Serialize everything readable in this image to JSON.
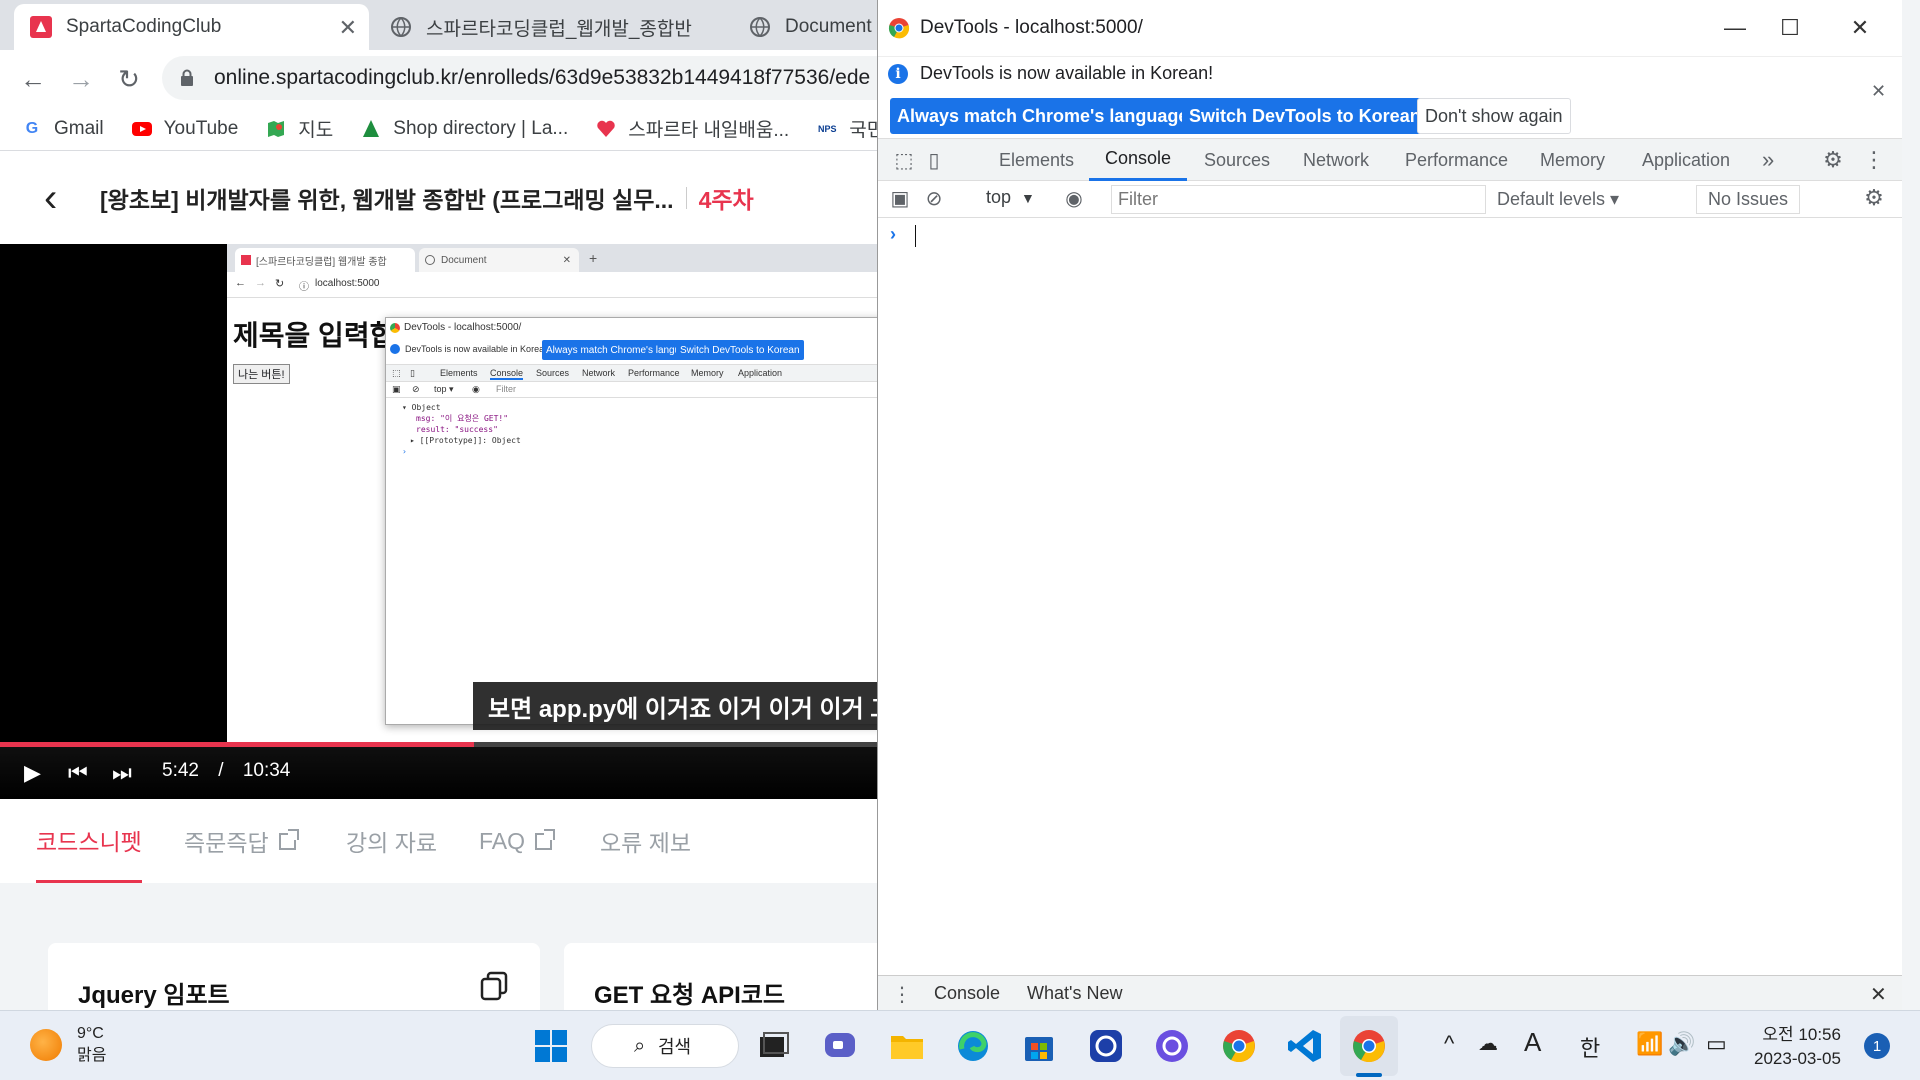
{
  "browser": {
    "tabs": [
      {
        "title": "SpartaCodingClub"
      },
      {
        "title": "스파르타코딩클럽_웹개발_종합반"
      },
      {
        "title": "Document"
      }
    ],
    "url": "online.spartacodingclub.kr/enrolleds/63d9e53832b1449418f77536/ede",
    "bookmarks": [
      {
        "label": "Gmail",
        "icon": "gmail-icon"
      },
      {
        "label": "YouTube",
        "icon": "youtube-icon"
      },
      {
        "label": "지도",
        "icon": "maps-icon"
      },
      {
        "label": "Shop directory | La...",
        "icon": "shop-icon"
      },
      {
        "label": "스파르타 내일배움...",
        "icon": "heart-icon"
      },
      {
        "label": "국민",
        "icon": "nps-icon"
      }
    ]
  },
  "course": {
    "title": "[왕초보] 비개발자를 위한, 웹개발 종합반 (프로그래밍 실무...",
    "week": "4주차"
  },
  "video": {
    "inner_tabs": [
      "[스파르타코딩클럽] 웹개발 종합",
      "Document"
    ],
    "inner_url": "localhost:5000",
    "inner_heading": "제목을 입력합",
    "inner_button": "나는 버튼!",
    "inner_devtools": {
      "title": "DevTools - localhost:5000/",
      "info": "DevTools is now available in Korean!",
      "btn1": "Always match Chrome's language",
      "btn2": "Switch DevTools to Korean",
      "tabs": [
        "Elements",
        "Console",
        "Sources",
        "Network",
        "Performance",
        "Memory",
        "Application"
      ],
      "context": "top ▾",
      "filter": "Filter",
      "object_label": "Object",
      "msg_line": "msg: \"이 요청은 GET!\"",
      "result_line": "result: \"success\"",
      "proto_line": "[[Prototype]]: Object"
    },
    "subtitle": "보면 app.py에 이거죠 이거 이거 이거 그",
    "current_time": "5:42",
    "separator": "/",
    "duration": "10:34",
    "progress_fraction": 0.54
  },
  "page_tabs": [
    {
      "label": "코드스니펫",
      "active": true,
      "external": false
    },
    {
      "label": "즉문즉답",
      "active": false,
      "external": true
    },
    {
      "label": "강의 자료",
      "active": false,
      "external": false
    },
    {
      "label": "FAQ",
      "active": false,
      "external": true
    },
    {
      "label": "오류 제보",
      "active": false,
      "external": false
    }
  ],
  "snippets": [
    {
      "title": "Jquery 임포트"
    },
    {
      "title": "GET 요청 API코드"
    }
  ],
  "devtools": {
    "window_title": "DevTools - localhost:5000/",
    "info_text": "DevTools is now available in Korean!",
    "btn_match": "Always match Chrome's language",
    "btn_switch": "Switch DevTools to Korean",
    "btn_dismiss": "Don't show again",
    "tabs": [
      "Elements",
      "Console",
      "Sources",
      "Network",
      "Performance",
      "Memory",
      "Application"
    ],
    "active_tab": "Console",
    "more_tabs": "»",
    "context": "top",
    "filter_placeholder": "Filter",
    "levels": "Default levels ▾",
    "issues": "No Issues",
    "prompt": "›",
    "drawer_tabs": [
      "Console",
      "What's New"
    ]
  },
  "taskbar": {
    "temperature": "9°C",
    "weather": "맑음",
    "search": "검색",
    "ime_a": "A",
    "ime_lang": "한",
    "time": "오전 10:56",
    "date": "2023-03-05",
    "notifications": "1"
  },
  "colors": {
    "accent": "#e8344e",
    "chrome_blue": "#1a73e8"
  }
}
